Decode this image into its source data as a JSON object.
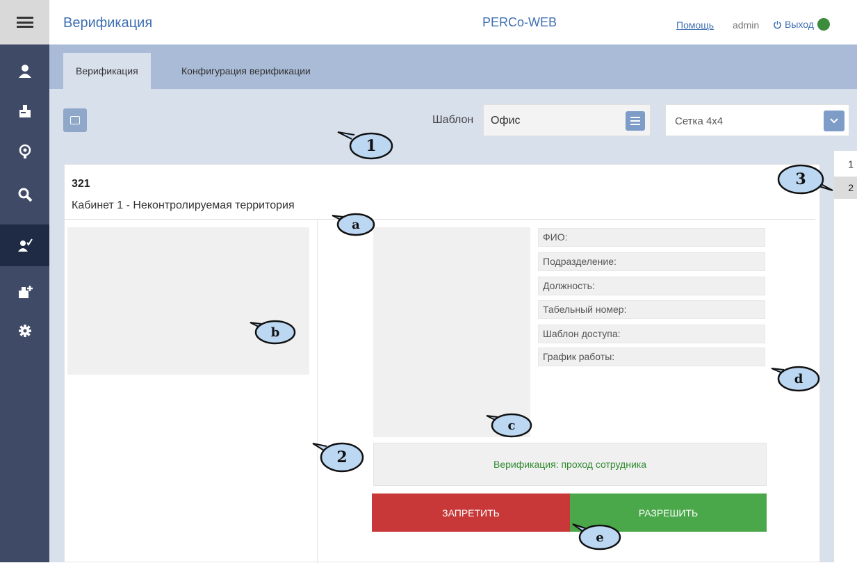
{
  "header": {
    "title": "Верификация",
    "brand": "PERCo-WEB",
    "help_link": "Помощь",
    "user": "admin",
    "logout_label": "Выход",
    "status_color": "#3d8b3d"
  },
  "sidebar": {
    "items": [
      {
        "icon": "employees-icon"
      },
      {
        "icon": "visitors-icon"
      },
      {
        "icon": "monitoring-icon"
      },
      {
        "icon": "search-icon"
      },
      {
        "icon": "verification-icon",
        "active": true
      },
      {
        "icon": "add-visitor-icon"
      },
      {
        "icon": "gear-icon"
      }
    ]
  },
  "tabs": [
    {
      "label": "Верификация",
      "active": true
    },
    {
      "label": "Конфигурация верификации",
      "active": false
    }
  ],
  "toolbar": {
    "template_label": "Шаблон",
    "template_value": "Офис",
    "grid_value": "Сетка 4х4"
  },
  "card": {
    "id": "321",
    "name": "Кабинет 1 - Неконтролируемая территория",
    "fields": [
      "ФИО:",
      "Подразделение:",
      "Должность:",
      "Табельный номер:",
      "Шаблон доступа:",
      "График работы:"
    ],
    "message": "Верификация: проход сотрудника",
    "deny_label": "ЗАПРЕТИТЬ",
    "allow_label": "РАЗРЕШИТЬ"
  },
  "pager": [
    "1",
    "2"
  ],
  "callouts": [
    "1",
    "2",
    "3",
    "a",
    "b",
    "c",
    "d",
    "e"
  ],
  "colors": {
    "accent": "#3f6fb1",
    "sidebar": "#3e4a66",
    "deny": "#c83838",
    "allow": "#4aa84a",
    "callout": "#bcd7f2"
  }
}
